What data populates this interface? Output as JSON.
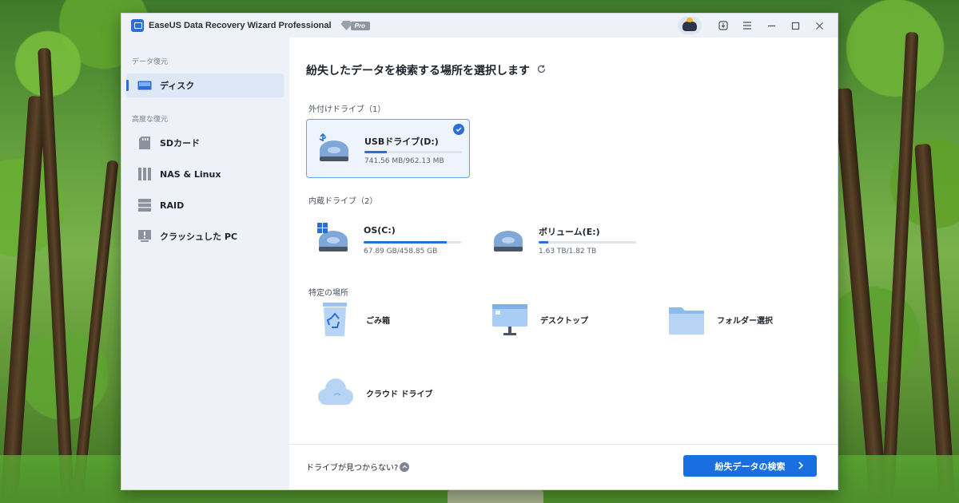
{
  "window": {
    "title": "EaseUS Data Recovery Wizard Professional",
    "badge": "Pro"
  },
  "sidebar": {
    "sections": [
      {
        "label": "データ復元"
      },
      {
        "label": "高度な復元"
      }
    ],
    "items": [
      {
        "label": "ディスク",
        "icon": "disk-icon",
        "active": true
      },
      {
        "label": "SDカード",
        "icon": "sd-card-icon"
      },
      {
        "label": "NAS & Linux",
        "icon": "nas-icon"
      },
      {
        "label": "RAID",
        "icon": "raid-icon"
      },
      {
        "label": "クラッシュした PC",
        "icon": "crashed-pc-icon"
      }
    ]
  },
  "main": {
    "title": "紛失したデータを検索する場所を選択します",
    "groups": {
      "external": "外付けドライブ（1）",
      "internal": "内蔵ドライブ（2）",
      "locations": "特定の場所"
    },
    "drives": [
      {
        "name": "USBドライブ(D:)",
        "size": "741.56 MB/962.13 MB",
        "used_fraction": 0.23,
        "selected": true,
        "icon": "usb-drive-icon"
      },
      {
        "name": "OS(C:)",
        "size": "67.89 GB/458.85 GB",
        "used_fraction": 0.85,
        "icon": "os-drive-icon"
      },
      {
        "name": "ボリューム(E:)",
        "size": "1.63 TB/1.82 TB",
        "used_fraction": 0.1,
        "icon": "volume-drive-icon"
      }
    ],
    "locations": [
      {
        "label": "ごみ箱",
        "icon": "recycle-bin-icon"
      },
      {
        "label": "デスクトップ",
        "icon": "desktop-icon"
      },
      {
        "label": "フォルダー選択",
        "icon": "folder-icon"
      },
      {
        "label": "クラウド ドライブ",
        "icon": "cloud-icon"
      }
    ]
  },
  "footer": {
    "help_text": "ドライブが見つからない?",
    "scan_button": "紛失データの検索"
  },
  "colors": {
    "accent": "#1a6fe0",
    "sidebar_bg": "#eef2f8",
    "selected_card": "#eef4fd"
  }
}
